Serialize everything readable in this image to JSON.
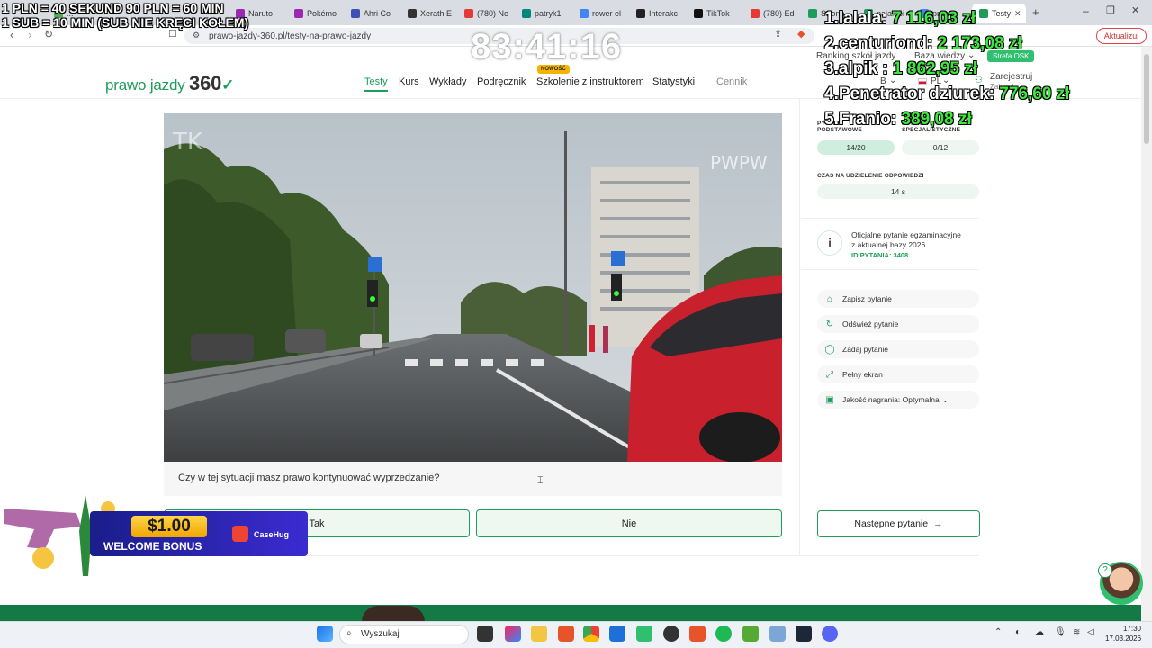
{
  "browser": {
    "tabs": [
      {
        "label": "...",
        "color": "#4caf50"
      },
      {
        "label": "Naruto",
        "color": "#9c27b0"
      },
      {
        "label": "Pokémo",
        "color": "#9c27b0"
      },
      {
        "label": "Ahri Co",
        "color": "#3f51b5"
      },
      {
        "label": "Xerath E",
        "color": "#333333"
      },
      {
        "label": "(780) Ne",
        "color": "#e53935"
      },
      {
        "label": "patryk1",
        "color": "#00897b"
      },
      {
        "label": "rower el",
        "color": "#4285f4"
      },
      {
        "label": "Interakc",
        "color": "#222222"
      },
      {
        "label": "TikTok",
        "color": "#111111"
      },
      {
        "label": "(780) Ed",
        "color": "#e53935"
      },
      {
        "label": "Strona",
        "color": "#1e9c5a"
      },
      {
        "label": "najalepi",
        "color": "#1e9c5a"
      },
      {
        "label": "prawo",
        "color": "#4285f4"
      },
      {
        "label": "Testy",
        "color": "#1e9c5a"
      }
    ],
    "url": "prawo-jazdy-360.pl/testy-na-prawo-jazdy",
    "update_label": "Aktualizuj"
  },
  "site": {
    "logo_text": "prawo jazdy",
    "logo_num": "360",
    "nav": [
      "Testy",
      "Kurs",
      "Wykłady",
      "Podręcznik",
      "Szkolenie z instruktorem",
      "Statystyki"
    ],
    "nav_new_badge": "NOWOŚĆ",
    "pricing": "Cennik",
    "top_links": [
      "Ranking szkół jazdy",
      "Baza wiedzy"
    ],
    "strefa": "Strefa OSK",
    "category": "B",
    "language": "PL",
    "register": "Zarejestruj",
    "login": "Zaloguj"
  },
  "video": {
    "watermark_left": "TK",
    "watermark_right": "PWPW"
  },
  "question": {
    "text": "Czy w tej sytuacji masz prawo kontynuować wyprzedzanie?",
    "answer_yes": "Tak",
    "answer_no": "Nie"
  },
  "sidebar": {
    "basic_label": "PYTANIA PODSTAWOWE",
    "special_label": "PYTANIA SPECJALISTYCZNE",
    "basic_value": "14/20",
    "special_value": "0/12",
    "time_label": "CZAS NA UDZIELENIE ODPOWIEDZI",
    "time_value": "14 s",
    "info_line1": "Oficjalne pytanie egzaminacyjne",
    "info_line2": "z aktualnej bazy 2026",
    "info_id": "ID PYTANIA: 3408",
    "actions": [
      "Zapisz pytanie",
      "Odśwież pytanie",
      "Zadaj pytanie",
      "Pełny ekran",
      "Jakość nagrania: Optymalna"
    ],
    "next": "Następne pytanie"
  },
  "overlay": {
    "line1": "1 PLN =  40 SEKUND 90 PLN = 60 MIN",
    "line2": "1 SUB = 10 MIN (SUB NIE KRĘCI KOŁEM)",
    "timer": "83:41:16",
    "ranking": [
      {
        "name": "1.lalala:",
        "amount": "7 116,03 zł"
      },
      {
        "name": "2.centuriond:",
        "amount": "2 173,08 zł"
      },
      {
        "name": "3.alpik :",
        "amount": "1 862,95 zł"
      },
      {
        "name": "4.Penetrator dziurek:",
        "amount": "776,60 zł"
      },
      {
        "name": "5.Franio:",
        "amount": "389,08 zł"
      }
    ],
    "promo_amount": "$1.00",
    "promo_label": "WELCOME BONUS",
    "promo_brand": "CaseHug"
  },
  "taskbar": {
    "search": "Wyszukaj",
    "time": "17:30",
    "date": "17.03.2026"
  },
  "colors": {
    "accent": "#1e9c5a",
    "rank_amount": "#3be83b"
  }
}
